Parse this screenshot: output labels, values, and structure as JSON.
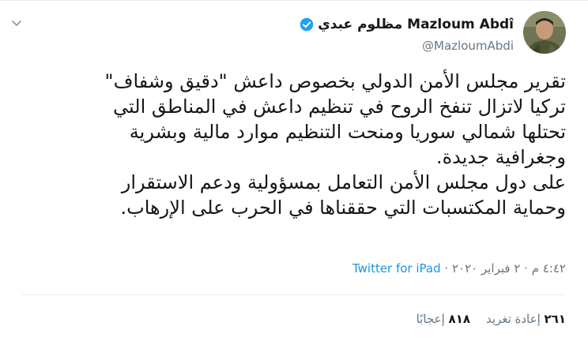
{
  "colors": {
    "accent": "#1b95e0",
    "verified": "#1da1f2",
    "text": "#14171a",
    "muted": "#657786",
    "divider": "#e6ecf0"
  },
  "icons": {
    "menu": "chevron-down-icon",
    "verified": "verified-badge-icon"
  },
  "author": {
    "display_name": "مظلوم عبدي Mazloum Abdî",
    "handle": "@MazloumAbdi"
  },
  "tweet": {
    "lines": [
      "تقرير مجلس الأمن الدولي بخصوص داعش \"دقيق وشفاف\"",
      "تركيا لاتزال تنفخ الروح في تنظيم داعش في المناطق التي",
      "تحتلها شمالي سوريا ومنحت التنظيم موارد مالية وبشرية",
      "وجغرافية جديدة.",
      "على دول مجلس الأمن التعامل بمسؤولية ودعم الاستقرار",
      "وحماية المكتسبات التي حققناها في الحرب على الإرهاب."
    ],
    "timestamp": "٤:٤٢ م · ٢ فبراير ٢٠٢٠ ·",
    "source": "Twitter for iPad"
  },
  "stats": {
    "retweets_count": "٢٦١",
    "retweets_label": "إعادة تغريد",
    "likes_count": "٨١٨",
    "likes_label": "إعجابًا"
  }
}
